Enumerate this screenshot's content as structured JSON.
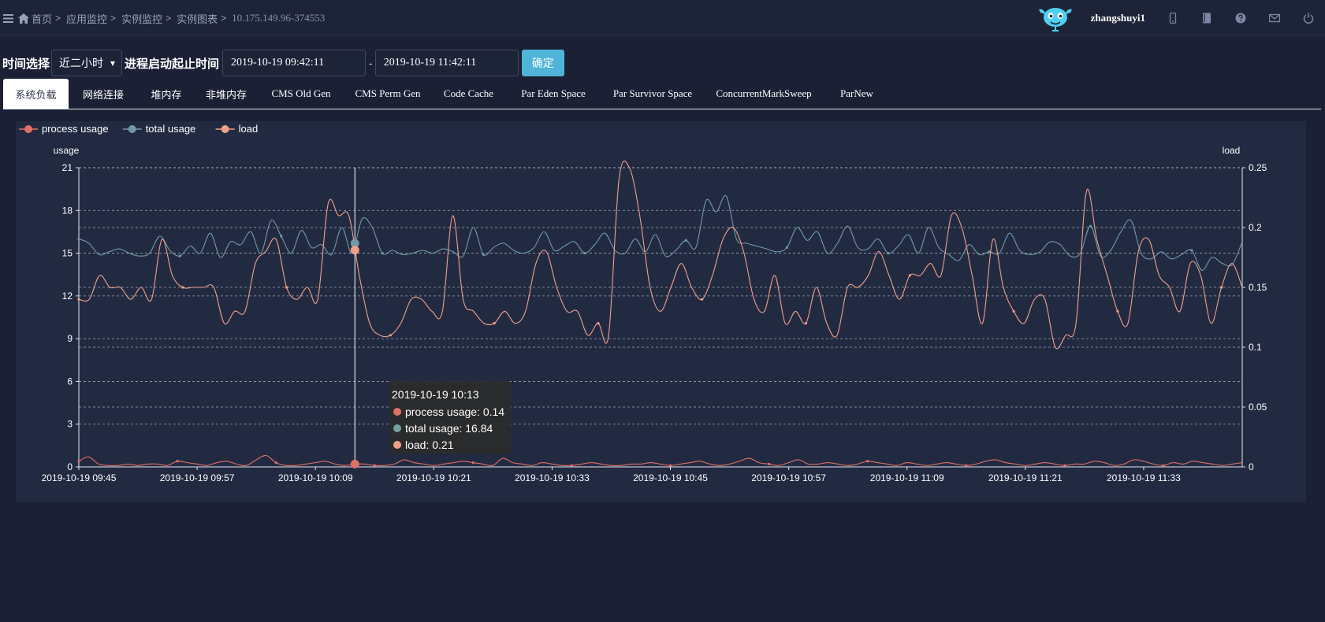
{
  "breadcrumb": {
    "home": "首页",
    "app_monitor": "应用监控",
    "instance_monitor": "实例监控",
    "instance_chart": "实例图表",
    "instance_id": "10.175.149.96-374553",
    "separator": ">"
  },
  "header": {
    "username": "zhangshuyi1",
    "icons": [
      "menu-icon",
      "home-icon",
      "avatar-robot-icon",
      "mobile-icon",
      "book-icon",
      "help-icon",
      "mail-icon",
      "power-icon"
    ]
  },
  "filter": {
    "time_label": "时间选择",
    "time_range": "近二小时",
    "process_time_label": "进程启动起止时间",
    "start_time": "2019-10-19 09:42:11",
    "end_time": "2019-10-19 11:42:11",
    "dash": "-",
    "confirm_label": "确定"
  },
  "tabs": [
    {
      "label": "系统负载",
      "active": true
    },
    {
      "label": "网络连接",
      "active": false
    },
    {
      "label": "堆内存",
      "active": false
    },
    {
      "label": "非堆内存",
      "active": false
    },
    {
      "label": "CMS Old Gen",
      "active": false
    },
    {
      "label": "CMS Perm Gen",
      "active": false
    },
    {
      "label": "Code Cache",
      "active": false
    },
    {
      "label": "Par Eden Space",
      "active": false
    },
    {
      "label": "Par Survivor Space",
      "active": false
    },
    {
      "label": "ConcurrentMarkSweep",
      "active": false
    },
    {
      "label": "ParNew",
      "active": false
    }
  ],
  "tooltip": {
    "time": "2019-10-19 10:13",
    "rows": [
      {
        "text": "process usage: 0.14",
        "color": "#e07066"
      },
      {
        "text": "total usage: 16.84",
        "color": "#76a0a0"
      },
      {
        "text": "load: 0.21",
        "color": "#f0a08a"
      }
    ]
  },
  "colors": {
    "process": "#e07066",
    "total": "#6f9aa6",
    "load": "#f0a08a",
    "accent": "#4fb4d8"
  },
  "chart_data": {
    "type": "line",
    "legend": [
      "process usage",
      "total usage",
      "load"
    ],
    "legend_position": "top-left",
    "ylabel_left": "usage",
    "ylabel_right": "load",
    "yticks_left": [
      "0",
      "3",
      "6",
      "9",
      "12",
      "15",
      "18",
      "21"
    ],
    "yticks_right": [
      "0",
      "0.05",
      "0.1",
      "0.15",
      "0.2",
      "0.25"
    ],
    "ylim_left": [
      0,
      21
    ],
    "ylim_right": [
      0,
      0.25
    ],
    "xticks": [
      "2019-10-19 09:45",
      "2019-10-19 09:57",
      "2019-10-19 10:09",
      "2019-10-19 10:21",
      "2019-10-19 10:33",
      "2019-10-19 10:45",
      "2019-10-19 10:57",
      "2019-10-19 11:09",
      "2019-10-19 11:21",
      "2019-10-19 11:33"
    ],
    "x_minutes_from_first_tick": [
      0,
      12,
      24,
      36,
      48,
      60,
      72,
      84,
      96,
      108
    ],
    "x_range_minutes": [
      0,
      118
    ],
    "grid": true,
    "series": [
      {
        "name": "process usage",
        "axis": "left",
        "values": [
          0.4,
          0.7,
          0.2,
          0.1,
          0.1,
          0.2,
          0.1,
          0.2,
          0.2,
          0.1,
          0.4,
          0.3,
          0.2,
          0.1,
          0.3,
          0.4,
          0.2,
          0.1,
          0.5,
          0.8,
          0.3,
          0.1,
          0.1,
          0.2,
          0.3,
          0.4,
          0.2,
          0.1,
          0.2,
          0.2,
          0.1,
          0.1,
          0.2,
          0.5,
          0.3,
          0.2,
          0.1,
          0.2,
          0.3,
          0.4,
          0.3,
          0.2,
          0.1,
          0.6,
          0.3,
          0.2,
          0.1,
          0.3,
          0.2,
          0.1,
          0.1,
          0.2,
          0.3,
          0.2,
          0.1,
          0.1,
          0.2,
          0.2,
          0.3,
          0.2,
          0.1,
          0.2,
          0.3,
          0.4,
          0.2,
          0.1,
          0.2,
          0.4,
          0.6,
          0.3,
          0.2,
          0.1,
          0.3,
          0.5,
          0.2,
          0.2,
          0.3,
          0.2,
          0.1,
          0.2,
          0.4,
          0.3,
          0.2,
          0.1,
          0.3,
          0.2,
          0.1,
          0.2,
          0.3,
          0.2,
          0.1,
          0.2,
          0.4,
          0.5,
          0.3,
          0.2,
          0.1,
          0.2,
          0.3,
          0.2,
          0.1,
          0.2,
          0.2,
          0.4,
          0.3,
          0.1,
          0.2,
          0.5,
          0.4,
          0.2,
          0.1,
          0.3,
          0.2,
          0.4,
          0.3,
          0.2,
          0.1,
          0.2,
          0.3
        ]
      },
      {
        "name": "total usage",
        "axis": "left",
        "values": [
          16.0,
          15.7,
          14.9,
          15.1,
          15.3,
          15.0,
          14.8,
          15.0,
          16.2,
          15.2,
          14.8,
          15.5,
          15.0,
          16.4,
          14.7,
          15.8,
          15.6,
          16.5,
          15.0,
          17.3,
          16.2,
          15.0,
          16.6,
          15.4,
          15.6,
          14.9,
          16.8,
          15.0,
          17.4,
          16.8,
          15.0,
          15.2,
          14.9,
          15.0,
          15.2,
          15.0,
          15.3,
          15.1,
          14.8,
          16.8,
          14.9,
          15.4,
          15.7,
          15.2,
          15.0,
          15.4,
          16.5,
          15.2,
          15.5,
          15.8,
          15.0,
          15.6,
          16.4,
          15.2,
          15.0,
          16.0,
          15.1,
          16.3,
          14.8,
          15.2,
          15.9,
          15.4,
          18.7,
          17.9,
          19.0,
          16.0,
          15.7,
          15.5,
          15.3,
          15.1,
          15.4,
          16.8,
          15.9,
          16.5,
          15.0,
          15.7,
          16.9,
          15.4,
          15.3,
          16.0,
          15.0,
          15.5,
          16.3,
          15.0,
          16.8,
          15.4,
          14.9,
          14.5,
          15.6,
          14.9,
          15.1,
          15.0,
          16.4,
          15.2,
          14.9,
          15.1,
          15.8,
          15.6,
          14.8,
          15.0,
          16.9,
          14.8,
          15.2,
          16.5,
          17.3,
          15.0,
          14.6,
          15.1,
          14.6,
          14.9,
          15.2,
          13.8,
          14.7,
          14.3,
          14.2,
          15.8
        ]
      },
      {
        "name": "load",
        "axis": "right",
        "values": [
          0.14,
          0.14,
          0.16,
          0.15,
          0.15,
          0.14,
          0.15,
          0.14,
          0.19,
          0.16,
          0.15,
          0.15,
          0.15,
          0.15,
          0.12,
          0.13,
          0.13,
          0.17,
          0.18,
          0.19,
          0.15,
          0.14,
          0.15,
          0.14,
          0.22,
          0.21,
          0.21,
          0.16,
          0.12,
          0.11,
          0.11,
          0.12,
          0.14,
          0.14,
          0.13,
          0.13,
          0.21,
          0.14,
          0.13,
          0.12,
          0.12,
          0.13,
          0.12,
          0.13,
          0.17,
          0.18,
          0.15,
          0.13,
          0.13,
          0.11,
          0.12,
          0.11,
          0.24,
          0.25,
          0.21,
          0.15,
          0.13,
          0.15,
          0.17,
          0.15,
          0.14,
          0.16,
          0.19,
          0.2,
          0.18,
          0.14,
          0.13,
          0.16,
          0.12,
          0.13,
          0.12,
          0.15,
          0.12,
          0.11,
          0.15,
          0.15,
          0.16,
          0.18,
          0.16,
          0.14,
          0.16,
          0.16,
          0.17,
          0.16,
          0.21,
          0.2,
          0.16,
          0.12,
          0.19,
          0.15,
          0.13,
          0.12,
          0.14,
          0.14,
          0.1,
          0.11,
          0.12,
          0.23,
          0.19,
          0.16,
          0.13,
          0.12,
          0.18,
          0.19,
          0.16,
          0.15,
          0.13,
          0.17,
          0.16,
          0.12,
          0.15,
          0.17,
          0.15
        ]
      }
    ],
    "hover_x_minutes": 28
  }
}
